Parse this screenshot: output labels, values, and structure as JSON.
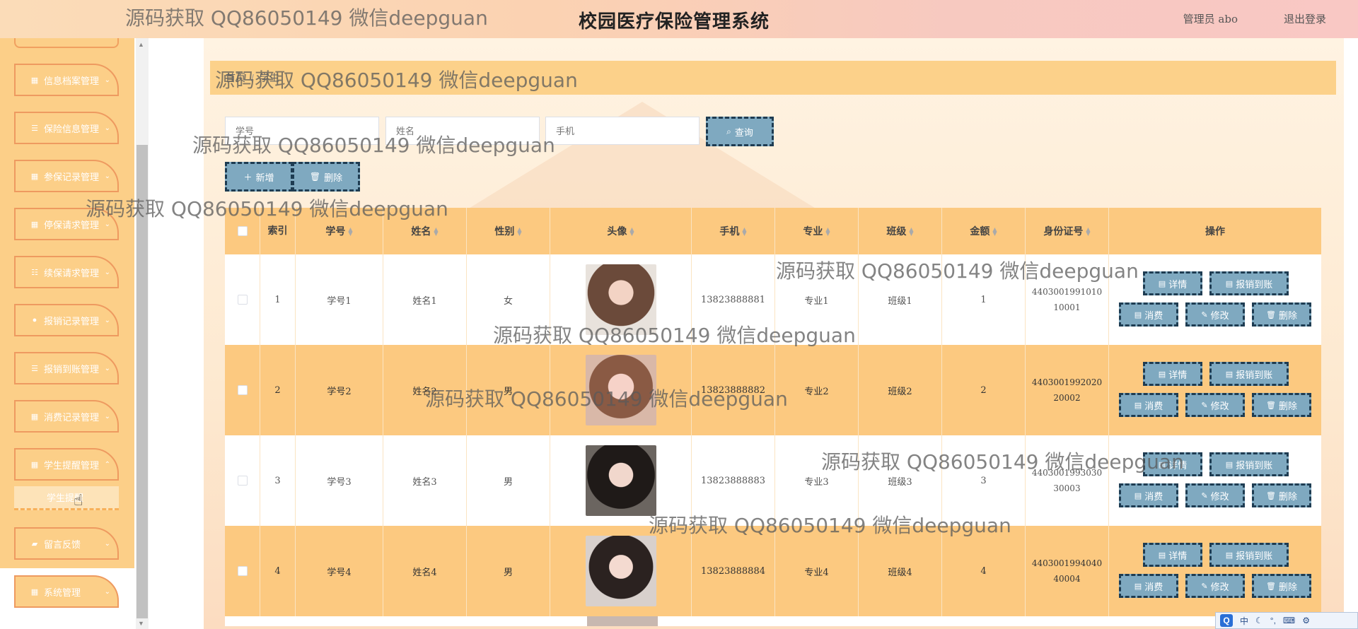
{
  "header": {
    "title": "校园医疗保险管理系统",
    "user_label": "管理员 abo",
    "logout_label": "退出登录"
  },
  "sidebar": {
    "items": [
      {
        "label": "信息档案管理",
        "icon": "grid-icon"
      },
      {
        "label": "保险信息管理",
        "icon": "menu-icon"
      },
      {
        "label": "参保记录管理",
        "icon": "grid-icon"
      },
      {
        "label": "停保请求管理",
        "icon": "grid-icon"
      },
      {
        "label": "续保请求管理",
        "icon": "sliders-icon"
      },
      {
        "label": "报销记录管理",
        "icon": "bulb-icon"
      },
      {
        "label": "报销到账管理",
        "icon": "menu-icon"
      },
      {
        "label": "消费记录管理",
        "icon": "grid-icon"
      },
      {
        "label": "学生提醒管理",
        "icon": "grid-icon"
      },
      {
        "label": "留言反馈",
        "icon": "briefcase-icon"
      },
      {
        "label": "系统管理",
        "icon": "grid-icon"
      }
    ],
    "sub_item": "学生提醒"
  },
  "breadcrumb": {
    "home": "首页",
    "current": "学生"
  },
  "search": {
    "field1_placeholder": "学号",
    "field2_placeholder": "姓名",
    "field3_placeholder": "手机",
    "query_label": "查询"
  },
  "actions": {
    "add_label": "新增",
    "delete_label": "删除"
  },
  "table": {
    "columns": [
      "索引",
      "学号",
      "姓名",
      "性别",
      "头像",
      "手机",
      "专业",
      "班级",
      "金额",
      "身份证号",
      "操作"
    ],
    "ops": {
      "detail": "详情",
      "reimburse": "报销到账",
      "consume": "消费",
      "edit": "修改",
      "delete": "删除"
    },
    "rows": [
      {
        "index": "1",
        "sid": "学号1",
        "name": "姓名1",
        "gender": "女",
        "phone": "13823888881",
        "major": "专业1",
        "class": "班级1",
        "amount": "1",
        "idcard": "440300199101010001"
      },
      {
        "index": "2",
        "sid": "学号2",
        "name": "姓名2",
        "gender": "男",
        "phone": "13823888882",
        "major": "专业2",
        "class": "班级2",
        "amount": "2",
        "idcard": "440300199202020002"
      },
      {
        "index": "3",
        "sid": "学号3",
        "name": "姓名3",
        "gender": "男",
        "phone": "13823888883",
        "major": "专业3",
        "class": "班级3",
        "amount": "3",
        "idcard": "440300199303030003"
      },
      {
        "index": "4",
        "sid": "学号4",
        "name": "姓名4",
        "gender": "男",
        "phone": "13823888884",
        "major": "专业4",
        "class": "班级4",
        "amount": "4",
        "idcard": "440300199404040004"
      }
    ]
  },
  "watermark": "源码获取 QQ86050149 微信deepguan",
  "ime": {
    "mode": "中"
  },
  "colors": {
    "sidebar": "#fccf88",
    "header_orange": "#fcc980",
    "button": "#7fa9c0",
    "button_border": "#1e3c52"
  }
}
